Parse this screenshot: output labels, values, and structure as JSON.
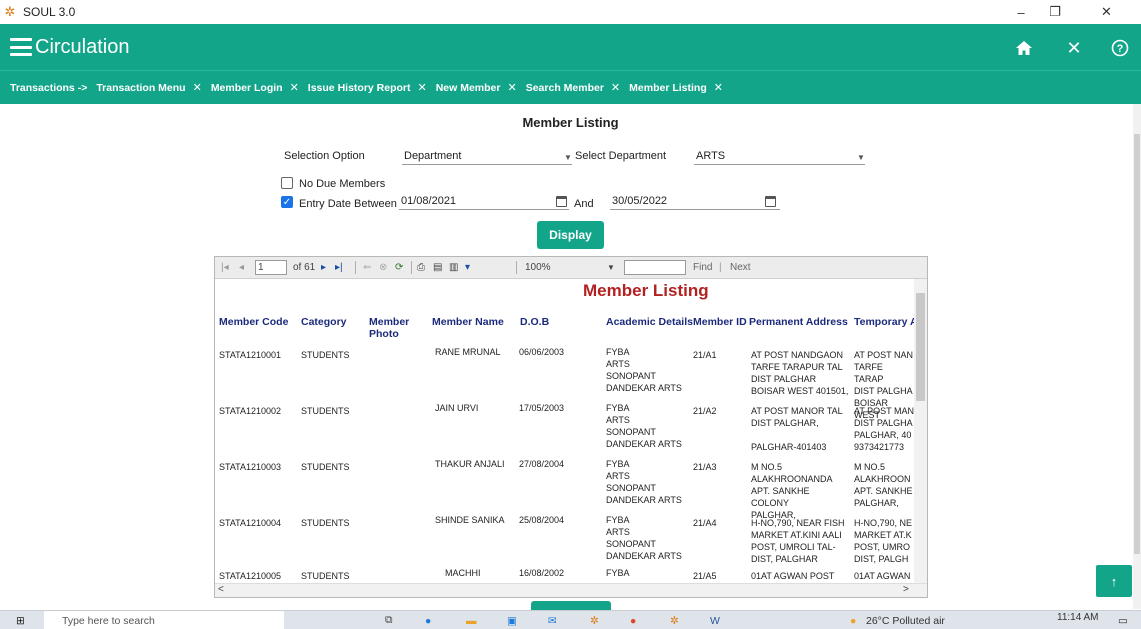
{
  "window": {
    "title": "SOUL 3.0",
    "controls": [
      "–",
      "❐",
      "✕"
    ]
  },
  "header": {
    "title": "Circulation"
  },
  "tabs": [
    {
      "label": "Transactions ->",
      "closable": false
    },
    {
      "label": "Transaction Menu",
      "closable": true
    },
    {
      "label": "Member Login",
      "closable": true
    },
    {
      "label": "Issue History Report",
      "closable": true
    },
    {
      "label": "New Member",
      "closable": true
    },
    {
      "label": "Search Member",
      "closable": true
    },
    {
      "label": "Member Listing",
      "closable": true,
      "active": true
    }
  ],
  "form": {
    "page_title": "Member Listing",
    "selection_option_label": "Selection Option",
    "selection_option_value": "Department",
    "select_department_label": "Select Department",
    "select_department_value": "ARTS",
    "no_due_members_label": "No Due Members",
    "no_due_members_checked": false,
    "entry_date_between_label": "Entry Date Between",
    "entry_date_between_checked": true,
    "date_from": "01/08/2021",
    "and_label": "And",
    "date_to": "30/05/2022",
    "display_button": "Display"
  },
  "report_toolbar": {
    "page_input": "1",
    "page_of": "of 61",
    "zoom": "100%",
    "find_label": "Find",
    "next_label": "Next"
  },
  "report": {
    "title": "Member Listing",
    "columns": [
      "Member Code",
      "Category",
      "Member Photo",
      "Member Name",
      "D.O.B",
      "Academic Details",
      "Member ID",
      "Permanent Address",
      "Temporary A"
    ],
    "rows": [
      {
        "member_code": "STATA1210001",
        "category": "STUDENTS",
        "member_name": "RANE MRUNAL",
        "dob": "06/06/2003",
        "academic": "FYBA\nARTS\nSONOPANT\nDANDEKAR ARTS",
        "member_id": "21/A1",
        "permanent": "AT POST NANDGAON\nTARFE TARAPUR TAL\nDIST PALGHAR\nBOISAR WEST 401501,",
        "temporary": "AT POST NAN\nTARFE TARAP\nDIST PALGHA\nBOISAR WEST"
      },
      {
        "member_code": "STATA1210002",
        "category": "STUDENTS",
        "member_name": "JAIN URVI",
        "dob": "17/05/2003",
        "academic": "FYBA\nARTS\nSONOPANT\nDANDEKAR ARTS",
        "member_id": "21/A2",
        "permanent": "AT POST MANOR TAL\nDIST PALGHAR,\n\nPALGHAR-401403",
        "temporary": "AT POST MAN\nDIST PALGHA\nPALGHAR, 40\n9373421773"
      },
      {
        "member_code": "STATA1210003",
        "category": "STUDENTS",
        "member_name": "THAKUR ANJALI",
        "dob": "27/08/2004",
        "academic": "FYBA\nARTS\nSONOPANT\nDANDEKAR ARTS",
        "member_id": "21/A3",
        "permanent": "M NO.5\nALAKHROONANDA\nAPT. SANKHE COLONY\nPALGHAR,",
        "temporary": "M NO.5\nALAKHROON\nAPT. SANKHE\nPALGHAR,"
      },
      {
        "member_code": "STATA1210004",
        "category": "STUDENTS",
        "member_name": "SHINDE SANIKA",
        "dob": "25/08/2004",
        "academic": "FYBA\nARTS\nSONOPANT\nDANDEKAR ARTS",
        "member_id": "21/A4",
        "permanent": "H-NO,790, NEAR FISH\nMARKET AT.KINI AALI\nPOST, UMROLI TAL-\nDIST, PALGHAR",
        "temporary": "H-NO,790, NE\nMARKET AT.K\nPOST, UMRO\nDIST, PALGH"
      },
      {
        "member_code": "STATA1210005",
        "category": "STUDENTS",
        "member_name": "MACHHI",
        "dob": "16/08/2002",
        "academic": "FYBA",
        "member_id": "21/A5",
        "permanent": "01AT AGWAN POST",
        "temporary": "01AT AGWAN"
      }
    ]
  },
  "taskbar": {
    "search_placeholder": "Type here to search",
    "weather": "26°C  Polluted air",
    "time": "11:14 AM"
  },
  "colors": {
    "accent": "#13a58a",
    "report_title": "#b22222",
    "header_text": "#1c2a7c"
  }
}
